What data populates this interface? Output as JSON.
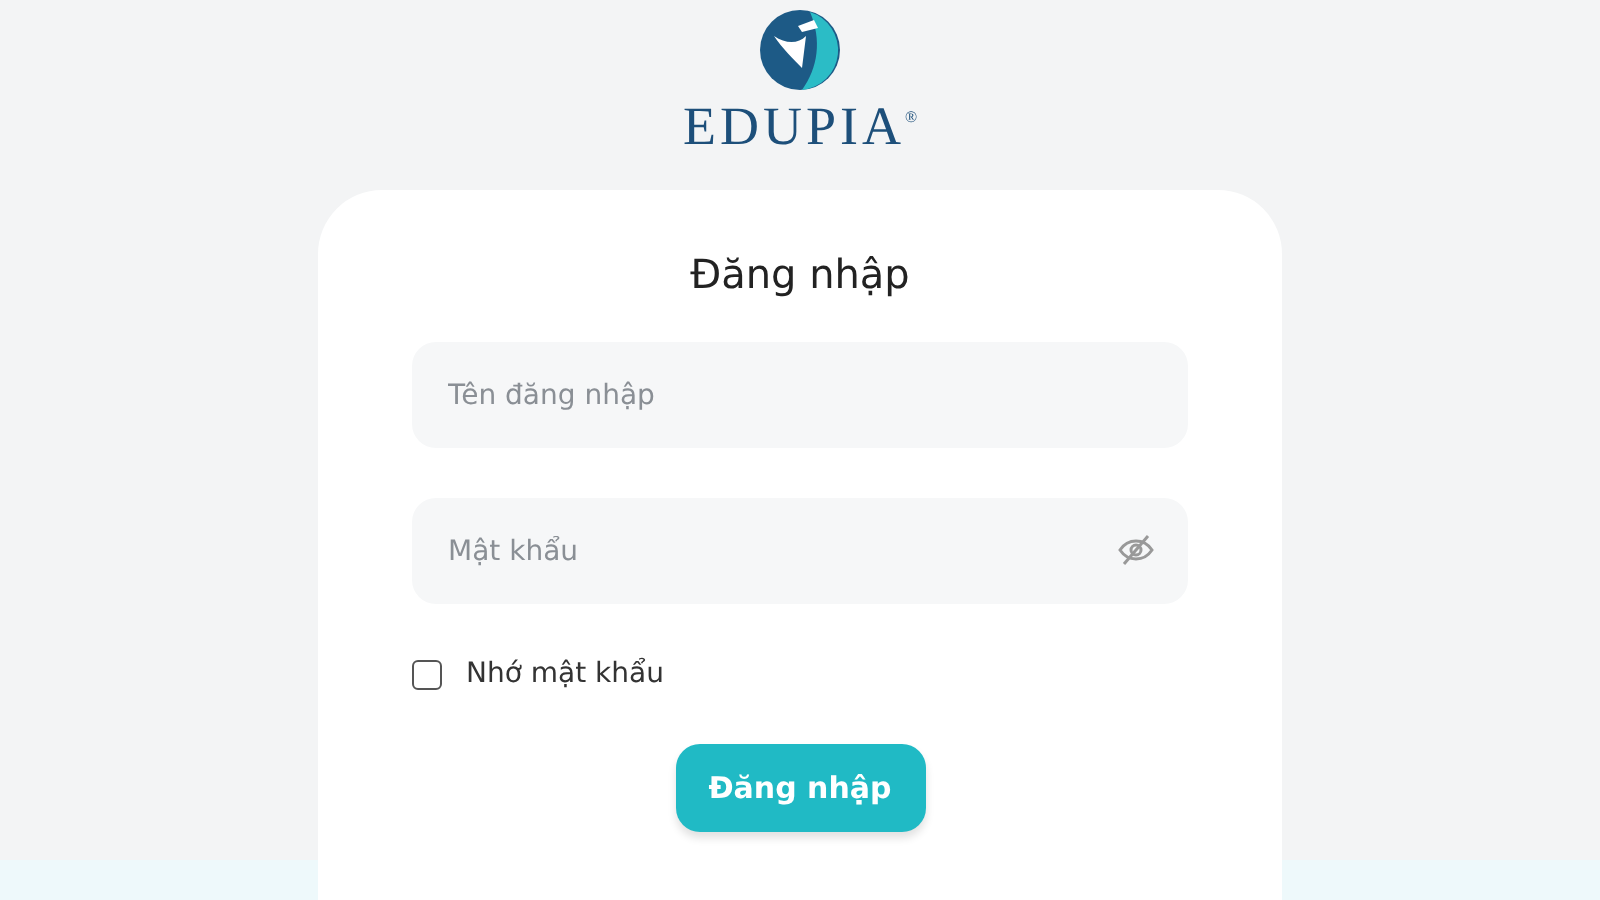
{
  "logo": {
    "text": "EDUPIA",
    "mark": "®"
  },
  "login": {
    "title": "Đăng nhập",
    "fields": [
      {
        "kind": "text",
        "placeholder": "Tên đăng nhập"
      },
      {
        "kind": "password",
        "placeholder": "Mật khẩu"
      }
    ],
    "remember": {
      "label": "Nhớ mật khẩu",
      "checked": false
    },
    "submit": "Đăng nhập"
  }
}
